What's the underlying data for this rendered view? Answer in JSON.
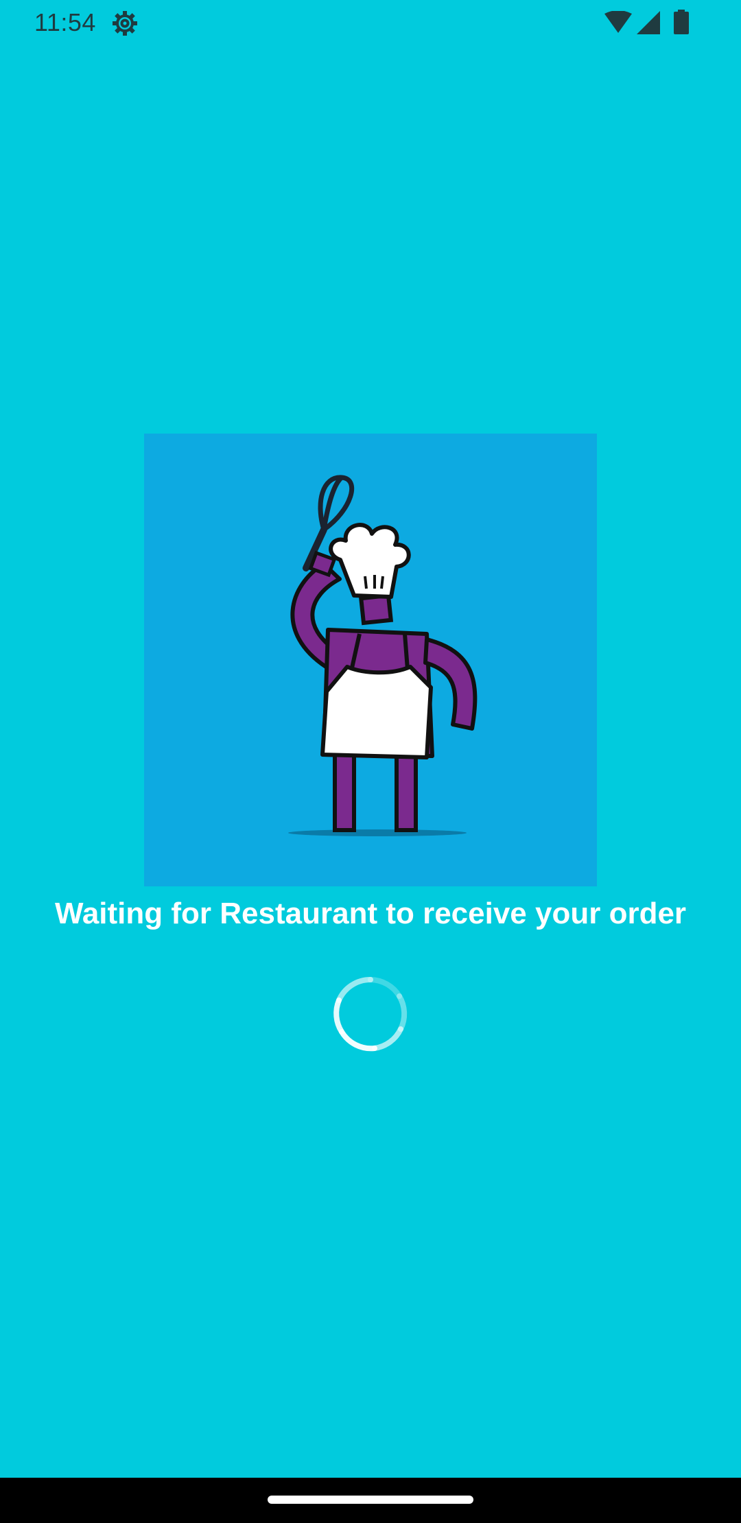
{
  "status_bar": {
    "time": "11:54",
    "icons": [
      "settings-icon",
      "wifi-icon",
      "signal-icon",
      "battery-icon"
    ]
  },
  "illustration": {
    "subject": "chef-holding-whisk"
  },
  "message": "Waiting for Restaurant to receive your order",
  "loading": true,
  "colors": {
    "background": "#01CBDD",
    "illustration_bg": "#0DAAE1",
    "chef_purple": "#7B2A8E",
    "text": "#FFFFFF",
    "nav_bar": "#000000"
  }
}
